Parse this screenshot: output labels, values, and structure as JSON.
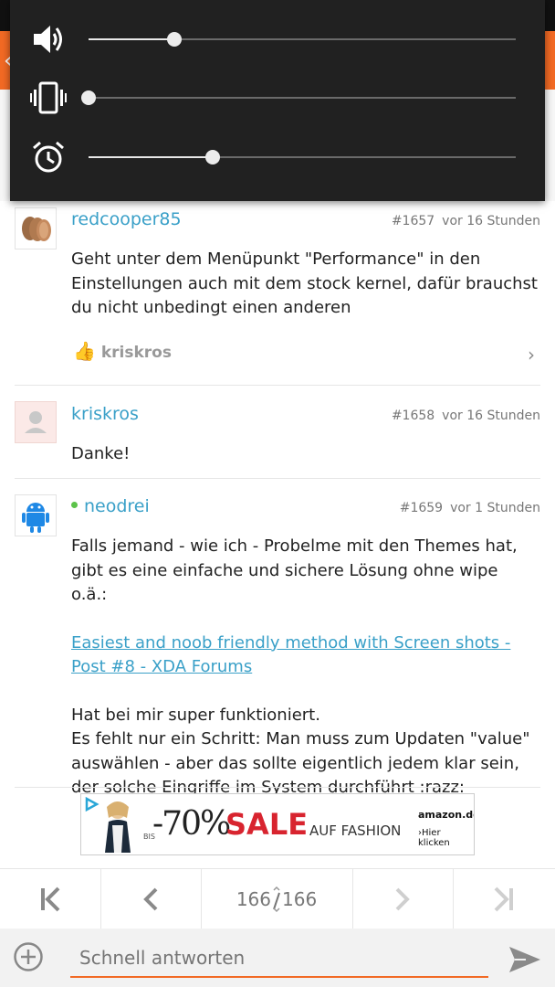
{
  "colors": {
    "accent": "#f26a24",
    "link": "#3aa0c8",
    "online": "#5cc34a"
  },
  "volume_panel": {
    "rows": [
      {
        "icon": "speaker-icon",
        "level": 0.2
      },
      {
        "icon": "vibrate-icon",
        "level": 0.0
      },
      {
        "icon": "alarm-clock-icon",
        "level": 0.29
      }
    ]
  },
  "posts": [
    {
      "username": "redcooper85",
      "number": "#1657",
      "time": "vor 16 Stunden",
      "text": "Geht unter dem Menüpunkt \"Performance\" in den Einstellungen auch mit dem stock kernel, dafür brauchst du nicht unbedingt einen anderen",
      "likes": {
        "icon": "thumbs-up-icon",
        "user": "kriskros"
      }
    },
    {
      "username": "kriskros",
      "number": "#1658",
      "time": "vor 16 Stunden",
      "text": "Danke!"
    },
    {
      "username": "neodrei",
      "online": true,
      "number": "#1659",
      "time": "vor 1 Stunden",
      "text_intro": "Falls jemand - wie ich - Probelme mit den Themes hat, gibt es eine einfache und sichere Lösung ohne wipe o.ä.:",
      "link_text": "Easiest and noob friendly method with Screen shots - Post #8 - XDA Forums",
      "text_line1": "Hat bei mir super funktioniert.",
      "text_line2": "Es fehlt nur ein Schritt: Man muss zum Updaten \"value\" auswählen - aber das sollte eigentlich jedem klar sein, der solche Eingriffe im System durchführt :razz:"
    }
  ],
  "ad": {
    "bis": "BIS",
    "discount": "-70%",
    "sale": "SALE",
    "on": "AUF FASHION",
    "brand": "amazon.de",
    "cta": "›Hier klicken"
  },
  "pagination": {
    "current": "166",
    "total": "166"
  },
  "reply": {
    "placeholder": "Schnell antworten"
  }
}
